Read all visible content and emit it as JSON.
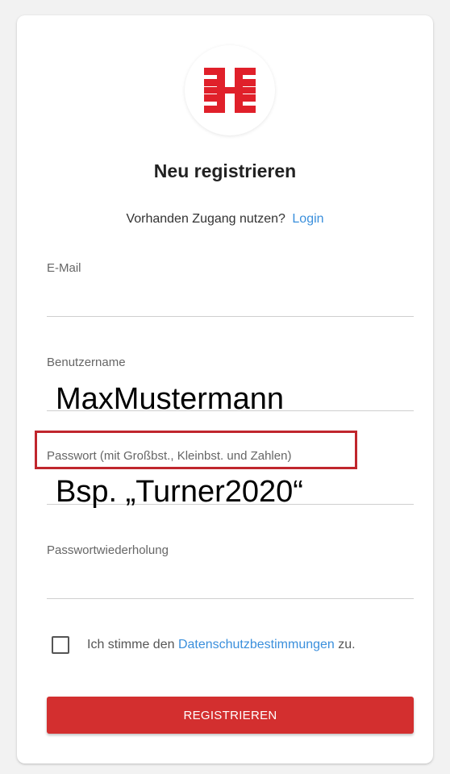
{
  "brand": {
    "accent_color": "#d32f2f",
    "link_color": "#3a8fdc",
    "logo_icon": "turner-cross-logo-icon"
  },
  "form": {
    "title": "Neu registrieren",
    "login_prompt": "Vorhanden Zugang nutzen?",
    "login_link": "Login",
    "fields": [
      {
        "label": "E-Mail",
        "value": ""
      },
      {
        "label": "Benutzername",
        "value": "MaxMustermann"
      },
      {
        "label": "Passwort (mit Großbst., Kleinbst. und Zahlen)",
        "value": ""
      },
      {
        "label": "Passwortwiederholung",
        "value": ""
      }
    ],
    "consent": {
      "text_before": "Ich stimme den",
      "link": "Datenschutzbestimmungen",
      "text_after": "zu.",
      "checked": false
    },
    "submit_label": "REGISTRIEREN"
  },
  "annotations": {
    "username_example": "MaxMustermann",
    "password_example": "Bsp. „Turner2020“"
  }
}
